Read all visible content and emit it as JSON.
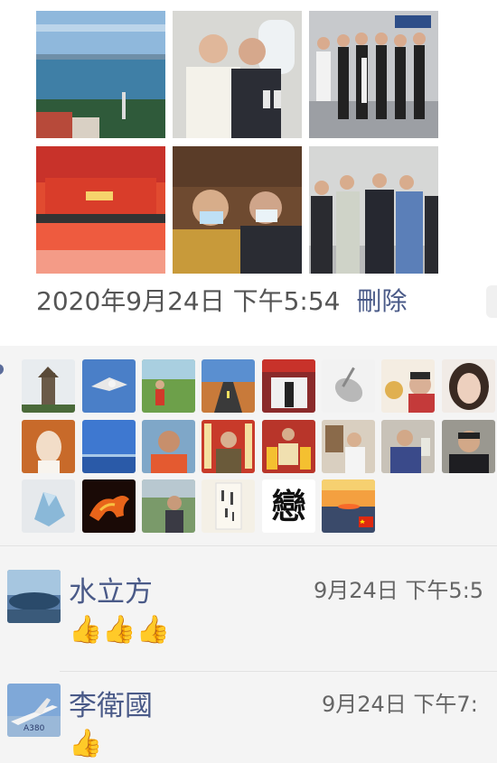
{
  "post": {
    "timestamp": "2020年9月24日 下午5:54",
    "delete_label": "刪除",
    "photos": [
      {
        "name": "photo-seaside-town"
      },
      {
        "name": "photo-two-men-airplane"
      },
      {
        "name": "photo-group-airport"
      },
      {
        "name": "photo-conference-hall"
      },
      {
        "name": "photo-two-men-masks"
      },
      {
        "name": "photo-group-indoor"
      }
    ]
  },
  "likes": {
    "avatars": [
      {
        "name": "avatar-pagoda"
      },
      {
        "name": "avatar-eagle"
      },
      {
        "name": "avatar-garden-person"
      },
      {
        "name": "avatar-road"
      },
      {
        "name": "avatar-storefront"
      },
      {
        "name": "avatar-violin"
      },
      {
        "name": "avatar-woman-cake"
      },
      {
        "name": "avatar-woman-portrait"
      },
      {
        "name": "avatar-figurine"
      },
      {
        "name": "avatar-ocean-sky"
      },
      {
        "name": "avatar-man-portrait"
      },
      {
        "name": "avatar-man-banner"
      },
      {
        "name": "avatar-award-ceremony"
      },
      {
        "name": "avatar-art-gallery"
      },
      {
        "name": "avatar-man-suit"
      },
      {
        "name": "avatar-man-selfie"
      },
      {
        "name": "avatar-crystal"
      },
      {
        "name": "avatar-fire-horse"
      },
      {
        "name": "avatar-man-outdoor"
      },
      {
        "name": "avatar-calligraphy"
      },
      {
        "name": "avatar-black-text"
      },
      {
        "name": "avatar-sunset-flag"
      }
    ],
    "calligraphy_text": "戀"
  },
  "comments": [
    {
      "name": "水立方",
      "time": "9月24日 下午5:5",
      "text": "👍👍👍"
    },
    {
      "name": "李衛國",
      "time": "9月24日 下午7:",
      "text": "👍",
      "avatar_text": "A380"
    }
  ]
}
